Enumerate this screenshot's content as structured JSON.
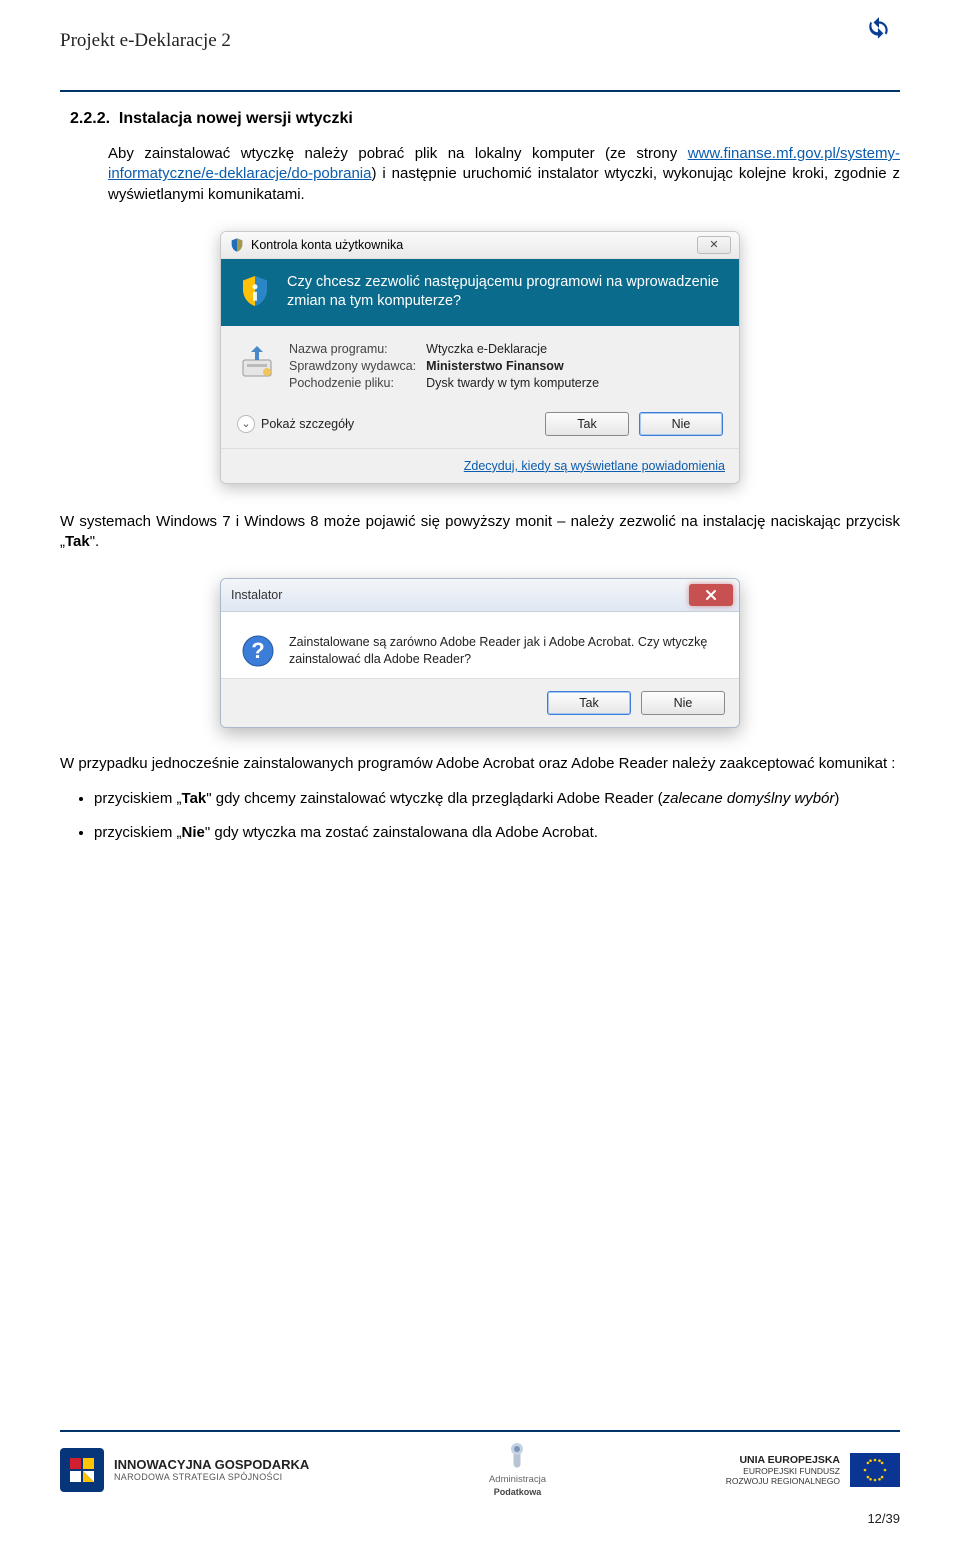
{
  "header": {
    "project_title": "Projekt e-Deklaracje 2"
  },
  "section": {
    "number": "2.2.2.",
    "title": "Instalacja nowej wersji wtyczki"
  },
  "intro": {
    "pre_link": "Aby zainstalować wtyczkę należy pobrać plik na lokalny komputer (ze strony ",
    "link": "www.finanse.mf.gov.pl/systemy-informatyczne/e-deklaracje/do-pobrania",
    "post_link": ") i następnie uruchomić instalator wtyczki, wykonując kolejne kroki, zgodnie z wyświetlanymi komunikatami."
  },
  "uac": {
    "title": "Kontrola konta użytkownika",
    "close_symbol": "✕",
    "question": "Czy chcesz zezwolić następującemu programowi na wprowadzenie zmian na tym komputerze?",
    "labels": {
      "program": "Nazwa programu:",
      "publisher": "Sprawdzony wydawca:",
      "origin": "Pochodzenie pliku:"
    },
    "values": {
      "program": "Wtyczka e-Deklaracje",
      "publisher": "Ministerstwo Finansow",
      "origin": "Dysk twardy w tym komputerze"
    },
    "show_details": "Pokaż szczegóły",
    "buttons": {
      "yes": "Tak",
      "no": "Nie"
    },
    "footer_link": "Zdecyduj, kiedy są wyświetlane powiadomienia"
  },
  "para_after_uac": {
    "pre": "W systemach Windows 7 i Windows 8 może pojawić się powyższy monit – należy zezwolić na instalację naciskając przycisk „",
    "bold": "Tak",
    "post": "\"."
  },
  "msg": {
    "title": "Instalator",
    "text": "Zainstalowane są zarówno Adobe Reader jak i Adobe Acrobat. Czy wtyczkę zainstalować dla Adobe Reader?",
    "buttons": {
      "yes": "Tak",
      "no": "Nie"
    }
  },
  "para_after_msg": "W przypadku jednocześnie zainstalowanych programów Adobe Acrobat oraz Adobe Reader należy zaakceptować komunikat :",
  "bullets": [
    {
      "pre": "przyciskiem „",
      "bold": "Tak",
      "mid": "\" gdy chcemy zainstalować wtyczkę dla przeglądarki Adobe Reader (",
      "italic": "zalecane domyślny wybór",
      "post": ")"
    },
    {
      "pre": "przyciskiem „",
      "bold": "Nie",
      "mid": "\" gdy wtyczka ma zostać zainstalowana dla Adobe Acrobat.",
      "italic": "",
      "post": ""
    }
  ],
  "footer": {
    "left": {
      "line1": "INNOWACYJNA GOSPODARKA",
      "line2": "NARODOWA STRATEGIA SPÓJNOŚCI"
    },
    "center": {
      "line1": "Administracja",
      "line2": "Podatkowa"
    },
    "right": {
      "line1": "UNIA EUROPEJSKA",
      "line2": "EUROPEJSKI FUNDUSZ",
      "line3": "ROZWOJU REGIONALNEGO"
    },
    "page": "12/39"
  }
}
